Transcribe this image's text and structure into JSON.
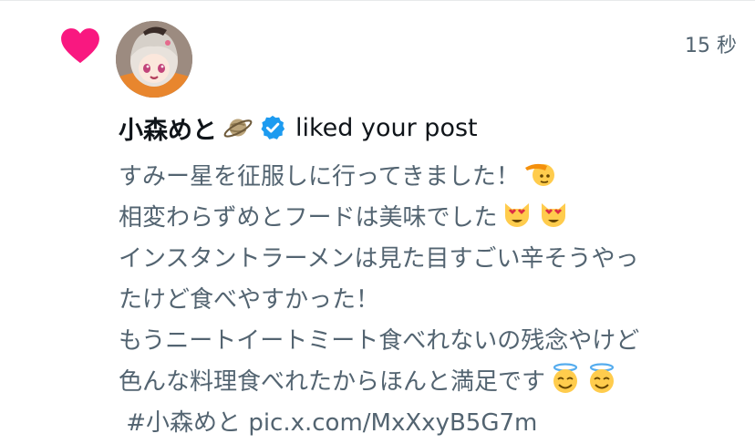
{
  "notification": {
    "type": "like",
    "timestamp": "15 秒",
    "user_name": "小森めと",
    "name_emoji": "saturn-planet",
    "verified": true,
    "action_text": "liked your post"
  },
  "post": {
    "lines": [
      "すみー星を征服しに行ってきました！",
      "相変わらずめとフードは美味でした",
      "インスタントラーメンは見た目すごい辛そうやっ",
      "たけど食べやすかった！",
      "もうニートイートミート食べれないの残念やけど",
      "色んな料理食べれたからほんと満足です"
    ],
    "line_emojis": {
      "line1": "saluting-face",
      "line2": [
        "heart-eyes-cat",
        "heart-eyes-cat"
      ],
      "line6": [
        "smiling-face-with-halo",
        "smiling-face-with-halo"
      ]
    },
    "hashtag": "#小森めと",
    "link": "pic.x.com/MxXxyB5G7m"
  },
  "colors": {
    "heart": "#f91880",
    "verified": "#1d9bf0",
    "text_primary": "#0f1419",
    "text_secondary": "#536471",
    "border": "#e7e9ea"
  }
}
